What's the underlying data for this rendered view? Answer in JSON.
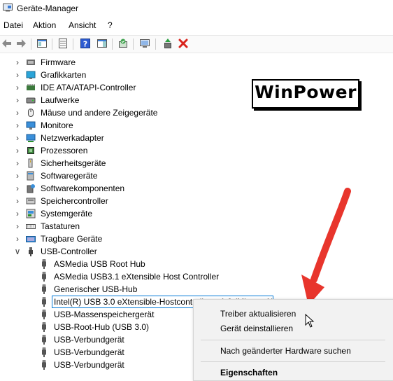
{
  "window": {
    "title": "Geräte-Manager"
  },
  "menu": [
    "Datei",
    "Aktion",
    "Ansicht",
    "?"
  ],
  "toolbar": {
    "icons": [
      "back-icon",
      "forward-icon",
      "show-hide-console-tree-icon",
      "properties-icon",
      "help-icon",
      "action-pane-icon",
      "scan-hardware-icon",
      "update-driver-icon",
      "enable-device-icon",
      "uninstall-device-icon"
    ]
  },
  "tree": {
    "categories": [
      {
        "label": "Firmware",
        "icon": "firmware-icon"
      },
      {
        "label": "Grafikkarten",
        "icon": "display-adapter-icon"
      },
      {
        "label": "IDE ATA/ATAPI-Controller",
        "icon": "ide-controller-icon"
      },
      {
        "label": "Laufwerke",
        "icon": "disk-drive-icon"
      },
      {
        "label": "Mäuse und andere Zeigegeräte",
        "icon": "mouse-icon"
      },
      {
        "label": "Monitore",
        "icon": "monitor-icon"
      },
      {
        "label": "Netzwerkadapter",
        "icon": "network-adapter-icon"
      },
      {
        "label": "Prozessoren",
        "icon": "processor-icon"
      },
      {
        "label": "Sicherheitsgeräte",
        "icon": "security-device-icon"
      },
      {
        "label": "Softwaregeräte",
        "icon": "software-device-icon"
      },
      {
        "label": "Softwarekomponenten",
        "icon": "software-component-icon"
      },
      {
        "label": "Speichercontroller",
        "icon": "storage-controller-icon"
      },
      {
        "label": "Systemgeräte",
        "icon": "system-device-icon"
      },
      {
        "label": "Tastaturen",
        "icon": "keyboard-icon"
      },
      {
        "label": "Tragbare Geräte",
        "icon": "portable-device-icon"
      },
      {
        "label": "USB-Controller",
        "icon": "usb-controller-icon"
      }
    ],
    "usb_children": [
      "ASMedia USB Root Hub",
      "ASMedia USB3.1 eXtensible Host Controller",
      "Generischer USB-Hub",
      "Intel(R) USB 3.0 eXtensible-Hostcontroller – 1.0 (Microsoft)",
      "USB-Massenspeichergerät",
      "USB-Root-Hub (USB 3.0)",
      "USB-Verbundgerät",
      "USB-Verbundgerät",
      "USB-Verbundgerät"
    ],
    "selected_index": 3
  },
  "context_menu": {
    "update": "Treiber aktualisieren",
    "uninstall": "Gerät deinstallieren",
    "scan": "Nach geänderter Hardware suchen",
    "properties": "Eigenschaften"
  },
  "watermark": "WinPower",
  "colors": {
    "selection": "#0078d7",
    "arrow": "#e8352c"
  }
}
